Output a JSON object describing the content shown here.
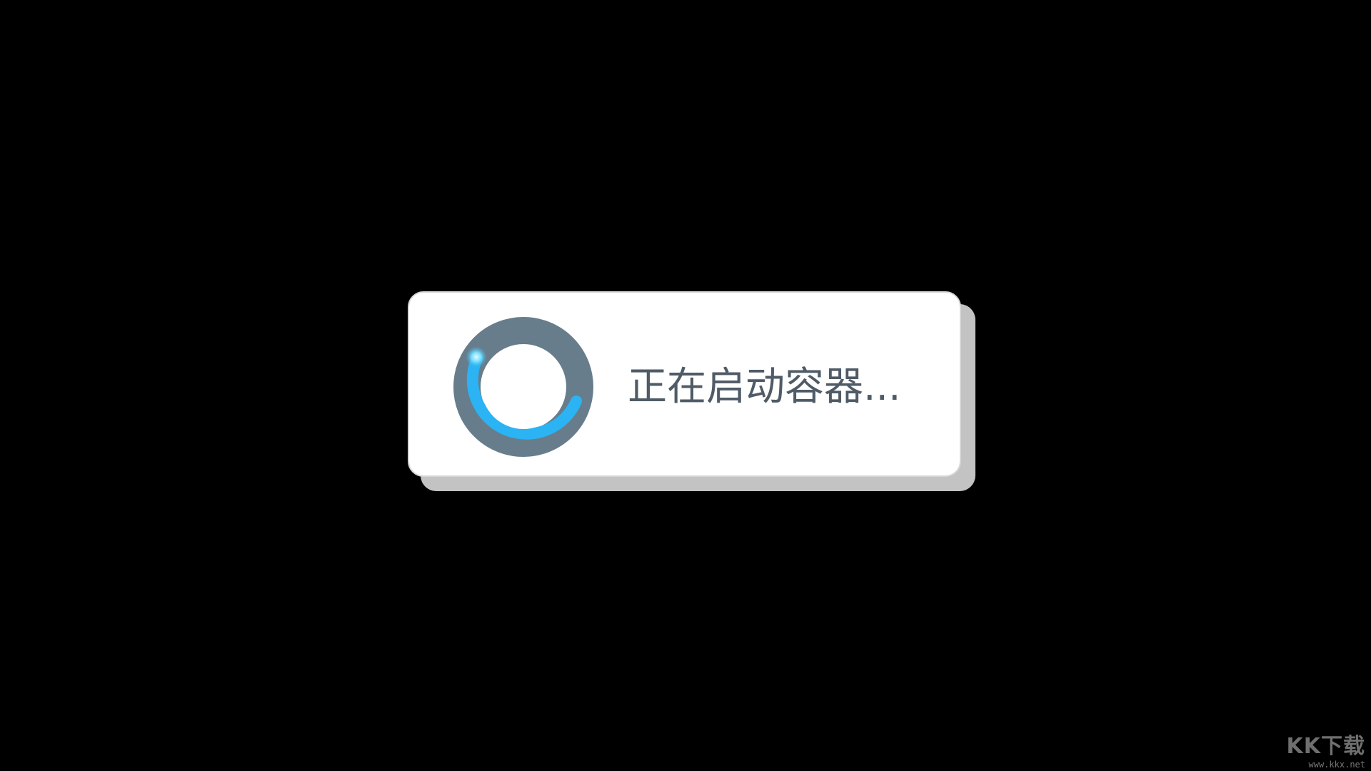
{
  "dialog": {
    "message": "正在启动容器...",
    "icon": "loading-spinner-icon"
  },
  "watermark": {
    "logo_text": "KK下载",
    "url": "www.kkx.net"
  },
  "colors": {
    "background": "#000000",
    "dialog_background": "#ffffff",
    "dialog_shadow": "#c3c3c3",
    "text": "#4f5b66",
    "spinner_ring": "#677d8c",
    "spinner_accent": "#2bb3f3"
  }
}
